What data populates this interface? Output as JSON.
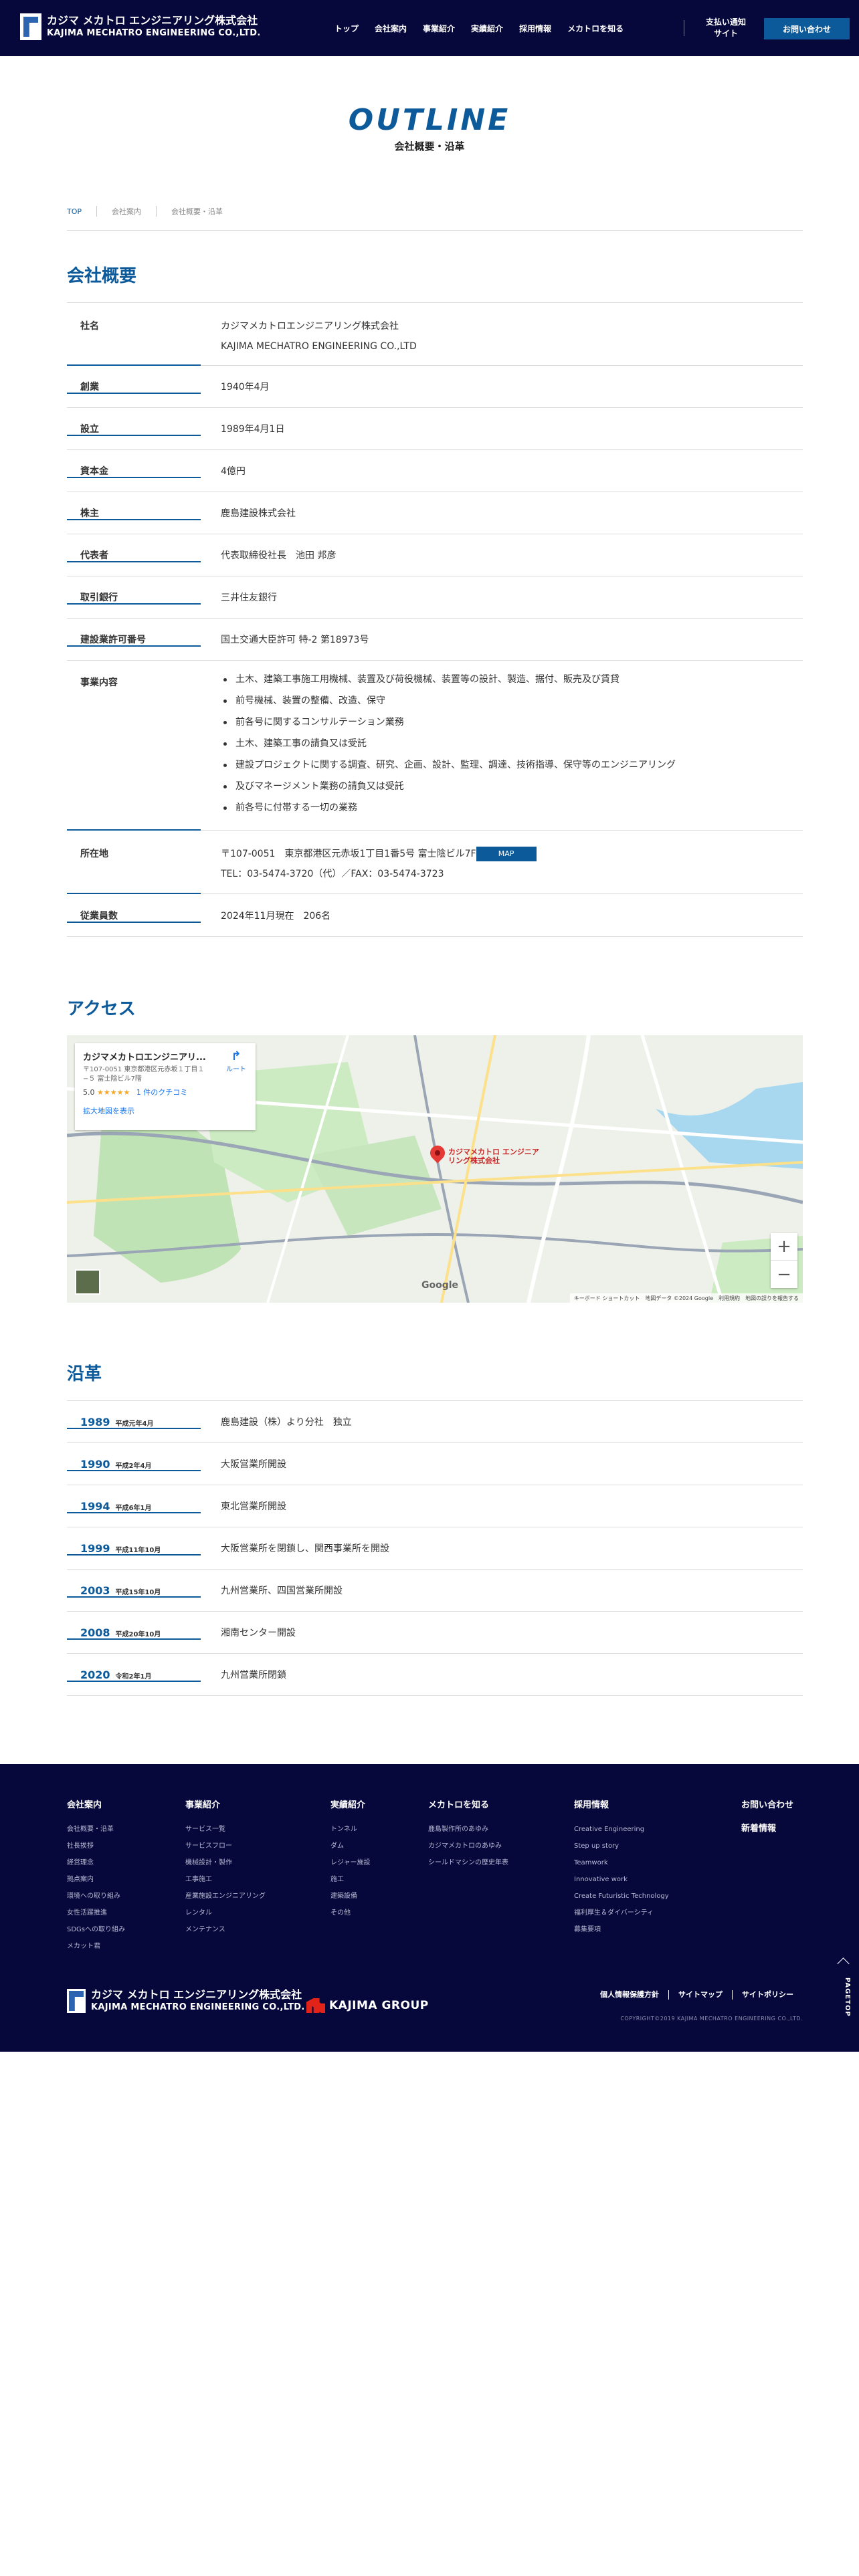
{
  "header": {
    "logo_jp": "カジマ メカトロ エンジニアリング株式会社",
    "logo_en": "KAJIMA MECHATRO ENGINEERING CO.,LTD.",
    "nav": [
      "トップ",
      "会社案内",
      "事業紹介",
      "実績紹介",
      "採用情報",
      "メカトロを知る"
    ],
    "payment_line1": "支払い通知",
    "payment_line2": "サイト",
    "contact": "お問い合わせ"
  },
  "page_title": {
    "en": "OUTLINE",
    "jp": "会社概要・沿革"
  },
  "breadcrumb": [
    "TOP",
    "会社案内",
    "会社概要・沿革"
  ],
  "outline": {
    "heading": "会社概要",
    "name_label": "社名",
    "name_jp": "カジマメカトロエンジニアリング株式会社",
    "name_en": "KAJIMA MECHATRO ENGINEERING CO.,LTD",
    "founded_label": "創業",
    "founded": "1940年4月",
    "established_label": "設立",
    "established": "1989年4月1日",
    "capital_label": "資本金",
    "capital": "4億円",
    "shareholder_label": "株主",
    "shareholder": "鹿島建設株式会社",
    "rep_label": "代表者",
    "rep": "代表取締役社長　池田 邦彦",
    "bank_label": "取引銀行",
    "bank": "三井住友銀行",
    "license_label": "建設業許可番号",
    "license": "国土交通大臣許可 特-2 第18973号",
    "business_label": "事業内容",
    "business": [
      "土木、建築工事施工用機械、装置及び荷役機械、装置等の設計、製造、据付、販売及び賃貸",
      "前号機械、装置の整備、改造、保守",
      "前各号に関するコンサルテーション業務",
      "土木、建築工事の請負又は受託",
      "建設プロジェクトに関する調査、研究、企画、設計、監理、調達、技術指導、保守等のエンジニアリング",
      "及びマネージメント業務の請負又は受託",
      "前各号に付帯する一切の業務"
    ],
    "address_label": "所在地",
    "address": "〒107-0051　東京都港区元赤坂1丁目1番5号 富士陰ビル7F",
    "map_button": "MAP",
    "tel": "TEL：03-5474-3720（代）／FAX：03-5474-3723",
    "employees_label": "従業員数",
    "employees": "2024年11月現在　206名"
  },
  "access": {
    "heading": "アクセス",
    "card_name": "カジマメカトロエンジニアリ...",
    "card_address": "〒107-0051 東京都港区元赤坂１丁目１−５ 富士陰ビル7階",
    "card_rating": "5.0",
    "card_stars": "★★★★★",
    "card_reviews": "1 件のクチコミ",
    "card_large_map": "拡大地図を表示",
    "card_route": "ルート",
    "pin_label": "カジマメカトロ エンジニアリング株式会社",
    "zoom_in": "+",
    "zoom_out": "−",
    "google": "Google",
    "map_footer": "キーボード ショートカット　地図データ ©2024 Google　利用規約　地図の誤りを報告する"
  },
  "history": {
    "heading": "沿革",
    "items": [
      {
        "year": "1989",
        "era": "平成元年4月",
        "text": "鹿島建設（株）より分社　独立"
      },
      {
        "year": "1990",
        "era": "平成2年4月",
        "text": "大阪営業所開設"
      },
      {
        "year": "1994",
        "era": "平成6年1月",
        "text": "東北営業所開設"
      },
      {
        "year": "1999",
        "era": "平成11年10月",
        "text": "大阪営業所を閉鎖し、関西事業所を開設"
      },
      {
        "year": "2003",
        "era": "平成15年10月",
        "text": "九州営業所、四国営業所開設"
      },
      {
        "year": "2008",
        "era": "平成20年10月",
        "text": "湘南センター開設"
      },
      {
        "year": "2020",
        "era": "令和2年1月",
        "text": "九州営業所閉鎖"
      }
    ]
  },
  "footer": {
    "cols": [
      {
        "title": "会社案内",
        "items": [
          "会社概要・沿革",
          "社長挨拶",
          "経営理念",
          "拠点案内",
          "環境への取り組み",
          "女性活躍推進",
          "SDGsへの取り組み",
          "メカット君"
        ]
      },
      {
        "title": "事業紹介",
        "items": [
          "サービス一覧",
          "サービスフロー",
          "機械設計・製作",
          "工事施工",
          "産業施設エンジニアリング",
          "レンタル",
          "メンテナンス"
        ]
      },
      {
        "title": "実績紹介",
        "items": [
          "トンネル",
          "ダム",
          "レジャー施設",
          "施工",
          "建築設備",
          "その他"
        ]
      },
      {
        "title": "メカトロを知る",
        "items": [
          "鹿島製作所のあゆみ",
          "カジマメカトロのあゆみ",
          "シールドマシンの歴史年表"
        ]
      },
      {
        "title": "採用情報",
        "items": [
          "Creative Engineering",
          "Step up story",
          "Teamwork",
          "Innovative work",
          "Create Futuristic Technology",
          "福利厚生＆ダイバーシティ",
          "募集要項"
        ]
      },
      {
        "title": "お問い合わせ",
        "items": []
      },
      {
        "title": "新着情報",
        "items": []
      }
    ],
    "logo_jp": "カジマ メカトロ エンジニアリング株式会社",
    "logo_en": "KAJIMA MECHATRO ENGINEERING CO.,LTD.",
    "group": "KAJIMA GROUP",
    "links": [
      "個人情報保護方針",
      "サイトマップ",
      "サイトポリシー"
    ],
    "copyright": "COPYRIGHT©2019 KAJIMA MECHATRO ENGINEERING CO.,LTD.",
    "pagetop": "PAGETOP"
  }
}
